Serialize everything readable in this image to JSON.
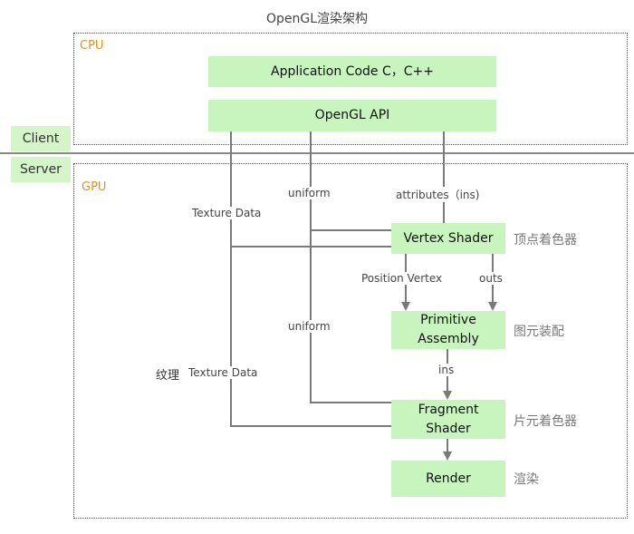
{
  "title": "OpenGL渲染架构",
  "regions": {
    "cpu_label": "CPU",
    "gpu_label": "GPU"
  },
  "sides": {
    "client": "Client",
    "server": "Server"
  },
  "boxes": {
    "application": "Application Code C，C++",
    "opengl_api": "OpenGL API",
    "vertex_shader": "Vertex Shader",
    "primitive_assembly": "Primitive Assembly",
    "fragment_shader": "Fragment Shader",
    "render": "Render"
  },
  "edge_labels": {
    "texture_data_top": "Texture Data",
    "uniform_top": "uniform",
    "attributes": "attributes（ins)",
    "position_vertex": "Position Vertex",
    "outs": "outs",
    "uniform_mid": "uniform",
    "ins": "ins",
    "texture_data_bottom": "Texture Data",
    "texture_cn": "纹理"
  },
  "annotations": {
    "vertex_shader_cn": "顶点着色器",
    "primitive_assembly_cn": "图元装配",
    "fragment_shader_cn": "片元着色器",
    "render_cn": "渲染"
  },
  "colors": {
    "box_fill": "#c8f5bd",
    "region_label": "#e8901a",
    "wire": "#7a7a7a"
  }
}
